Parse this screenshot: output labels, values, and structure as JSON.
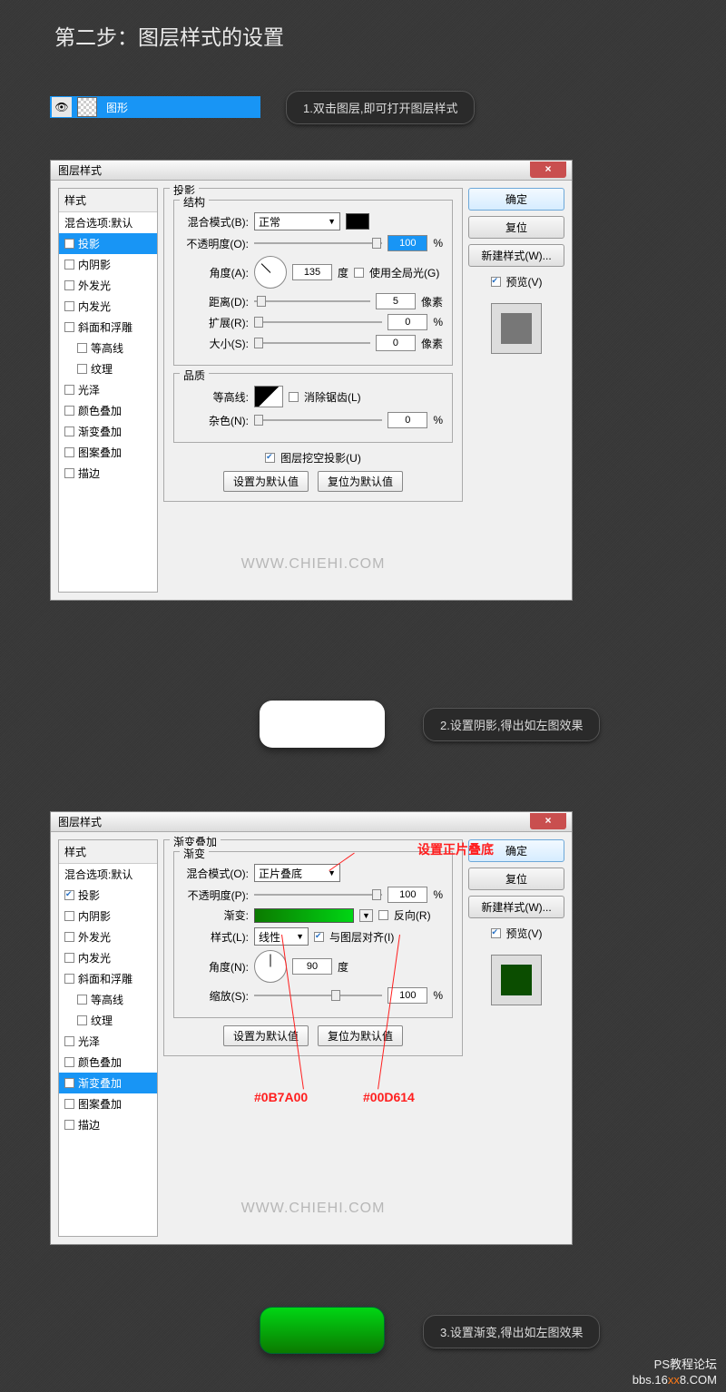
{
  "heading": "第二步：图层样式的设置",
  "layer": {
    "name": "图形"
  },
  "pills": {
    "p1": "1.双击图层,即可打开图层样式",
    "p2": "2.设置阴影,得出如左图效果",
    "p3": "3.设置渐变,得出如左图效果"
  },
  "dialog": {
    "title": "图层样式",
    "styles_header": "样式",
    "blend_default": "混合选项:默认",
    "items": {
      "dropshadow": "投影",
      "innershadow": "内阴影",
      "outerglow": "外发光",
      "innerglow": "内发光",
      "bevel": "斜面和浮雕",
      "contour": "等高线",
      "texture": "纹理",
      "satin": "光泽",
      "coloroverlay": "颜色叠加",
      "gradoverlay": "渐变叠加",
      "patternoverlay": "图案叠加",
      "stroke": "描边"
    },
    "panel_dropshadow": {
      "title": "投影",
      "struct": "结构",
      "blendmode_lbl": "混合模式(B):",
      "blendmode_val": "正常",
      "opacity_lbl": "不透明度(O):",
      "opacity_val": "100",
      "angle_lbl": "角度(A):",
      "angle_val": "135",
      "angle_unit": "度",
      "global": "使用全局光(G)",
      "distance_lbl": "距离(D):",
      "distance_val": "5",
      "distance_unit": "像素",
      "spread_lbl": "扩展(R):",
      "spread_val": "0",
      "spread_unit": "%",
      "size_lbl": "大小(S):",
      "size_val": "0",
      "size_unit": "像素",
      "quality": "品质",
      "contour_lbl": "等高线:",
      "antialias": "消除锯齿(L)",
      "noise_lbl": "杂色(N):",
      "noise_val": "0",
      "noise_unit": "%",
      "knockout": "图层挖空投影(U)",
      "set_default": "设置为默认值",
      "reset_default": "复位为默认值"
    },
    "panel_gradient": {
      "title": "渐变叠加",
      "grad": "渐变",
      "blendmode_lbl": "混合模式(O):",
      "blendmode_val": "正片叠底",
      "opacity_lbl": "不透明度(P):",
      "opacity_val": "100",
      "grad_lbl": "渐变:",
      "reverse": "反向(R)",
      "style_lbl": "样式(L):",
      "style_val": "线性",
      "align": "与图层对齐(I)",
      "angle_lbl": "角度(N):",
      "angle_val": "90",
      "angle_unit": "度",
      "scale_lbl": "缩放(S):",
      "scale_val": "100",
      "scale_unit": "%",
      "set_default": "设置为默认值",
      "reset_default": "复位为默认值"
    },
    "right": {
      "ok": "确定",
      "cancel": "复位",
      "newstyle": "新建样式(W)...",
      "preview": "预览(V)"
    }
  },
  "annotations": {
    "multiply": "设置正片叠底",
    "hex1": "#0B7A00",
    "hex2": "#00D614"
  },
  "watermark": "WWW.CHIEHI.COM",
  "footer": {
    "l1": "PS教程论坛",
    "l2a": "bbs.16",
    "l2b": "xx",
    "l2c": "8.COM"
  }
}
